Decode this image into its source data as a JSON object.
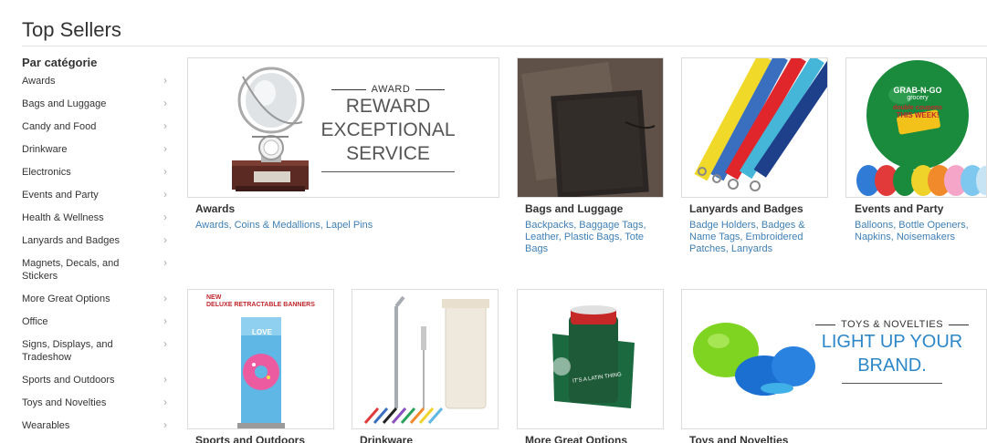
{
  "page": {
    "title": "Top Sellers"
  },
  "sidebar": {
    "heading": "Par catégorie",
    "items": [
      {
        "label": "Awards"
      },
      {
        "label": "Bags and Luggage"
      },
      {
        "label": "Candy and Food"
      },
      {
        "label": "Drinkware"
      },
      {
        "label": "Electronics"
      },
      {
        "label": "Events and Party"
      },
      {
        "label": "Health & Wellness"
      },
      {
        "label": "Lanyards and Badges"
      },
      {
        "label": "Magnets, Decals, and Stickers"
      },
      {
        "label": "More Great Options"
      },
      {
        "label": "Office"
      },
      {
        "label": "Signs, Displays, and Tradeshow"
      },
      {
        "label": "Sports and Outdoors"
      },
      {
        "label": "Toys and Novelties"
      },
      {
        "label": "Wearables"
      }
    ],
    "chevron_icon": "chevron-right-icon"
  },
  "tiles": {
    "awards": {
      "title": "Awards",
      "links": "Awards, Coins & Medallions, Lapel Pins",
      "banner": {
        "kicker": "AWARD",
        "line1": "REWARD",
        "line2": "EXCEPTIONAL",
        "line3": "SERVICE"
      }
    },
    "bags": {
      "title": "Bags and Luggage",
      "links": "Backpacks, Baggage Tags, Leather, Plastic Bags, Tote Bags"
    },
    "lanyards": {
      "title": "Lanyards and Badges",
      "links": "Badge Holders, Badges & Name Tags, Embroidered Patches, Lanyards"
    },
    "events": {
      "title": "Events and Party",
      "links": "Balloons, Bottle Openers, Napkins, Noisemakers",
      "balloon_text": {
        "brand": "GRAB-N-GO",
        "sub": "grocery",
        "coupon": "double coupons",
        "week": "THIS WEEK!"
      }
    },
    "sports": {
      "title": "Sports and Outdoors",
      "banner": {
        "tag1": "NEW",
        "tag2": "DELUXE RETRACTABLE BANNERS",
        "love": "LOVE"
      }
    },
    "drinkware": {
      "title": "Drinkware"
    },
    "more": {
      "title": "More Great Options",
      "koozie_text": "IT'S A LATIN THING"
    },
    "toys": {
      "title": "Toys and Novelties",
      "banner": {
        "kicker": "TOYS & NOVELTIES",
        "line1": "LIGHT UP YOUR",
        "line2": "BRAND."
      }
    }
  },
  "colors": {
    "link": "#3f7fb5",
    "accent_blue": "#2c87c8",
    "border": "#dcdcdc"
  }
}
